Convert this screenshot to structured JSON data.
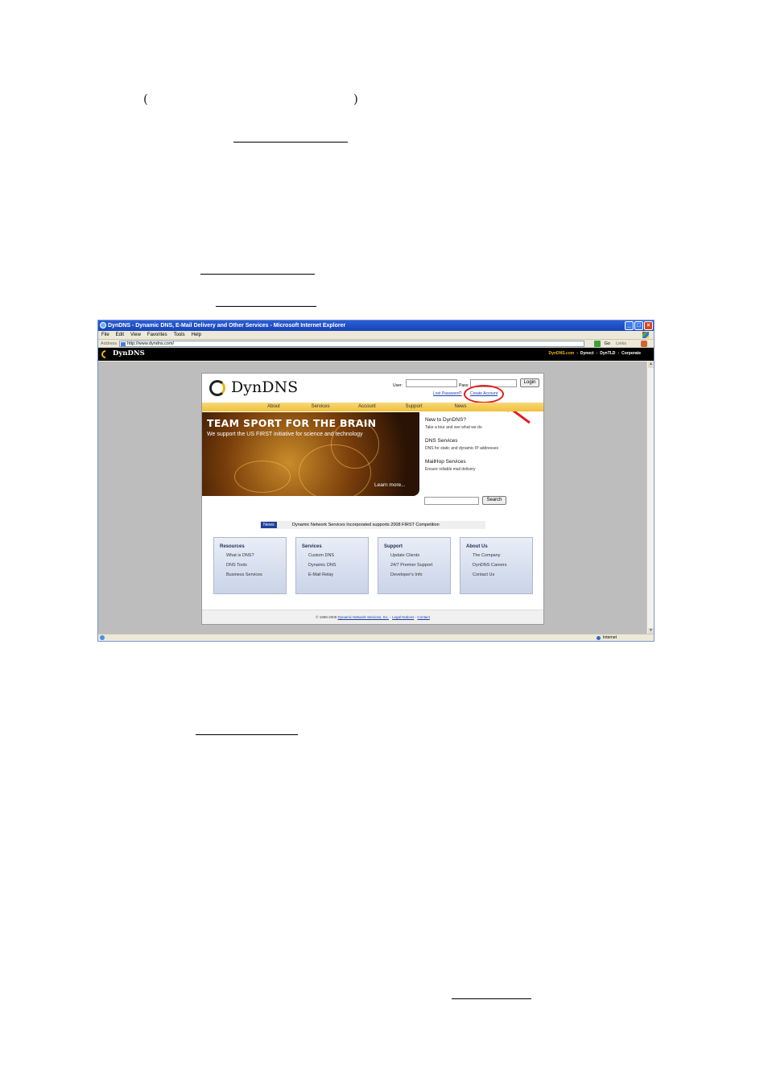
{
  "document": {
    "paren_open": "(",
    "paren_close": ")"
  },
  "browser": {
    "title": "DynDNS - Dynamic DNS, E-Mail Delivery and Other Services - Microsoft Internet Explorer",
    "menu": [
      "File",
      "Edit",
      "View",
      "Favorites",
      "Tools",
      "Help"
    ],
    "address_label": "Address",
    "address_value": "http://www.dyndns.com/",
    "go_label": "Go",
    "links_label": "Links",
    "status_zone": "Internet"
  },
  "dyn_topbar": {
    "brand": "DynDNS",
    "links": [
      "DynDNS.com",
      "Dynect",
      "DynTLD",
      "Corporate"
    ],
    "separator": "›"
  },
  "header": {
    "logo_text": "DynDNS",
    "user_label": "User:",
    "pass_label": "Pass:",
    "login_button": "Login",
    "lost_password": "Lost Password?",
    "create_account": "Create Account"
  },
  "nav": [
    "About",
    "Services",
    "Account",
    "Support",
    "News"
  ],
  "hero": {
    "title": "TEAM SPORT FOR THE BRAIN",
    "subtitle": "We support the US FIRST initiative for science and technology",
    "learn_more": "Learn more..."
  },
  "sidebar": [
    {
      "heading": "New to DynDNS?",
      "desc": "Take a tour and see what we do"
    },
    {
      "heading": "DNS Services",
      "desc": "DNS for static and dynamic IP addresses"
    },
    {
      "heading": "MailHop Services",
      "desc": "Ensure reliable mail delivery"
    }
  ],
  "search_button": "Search",
  "news": {
    "tag": "News",
    "text": "Dynamic Network Services Incorporated supports 2008 FIRST Competition"
  },
  "boxes": [
    {
      "heading": "Resources",
      "items": [
        "What is DNS?",
        "DNS Tools",
        "Business Services"
      ]
    },
    {
      "heading": "Services",
      "items": [
        "Custom DNS",
        "Dynamic DNS",
        "E-Mail Relay"
      ]
    },
    {
      "heading": "Support",
      "items": [
        "Update Clients",
        "24/7 Premier Support",
        "Developer's Info"
      ]
    },
    {
      "heading": "About Us",
      "items": [
        "The Company",
        "DynDNS Careers",
        "Contact Us"
      ]
    }
  ],
  "footer": {
    "copyright": "© 1998-2008",
    "company": "Dynamic Network Services, Inc.",
    "legal": "Legal Notices",
    "contact": "Contact",
    "separator": "-"
  },
  "colors": {
    "annotation": "#e41c1c",
    "nav_gold": "#f0c03a",
    "brand_yellow": "#f2b422"
  }
}
